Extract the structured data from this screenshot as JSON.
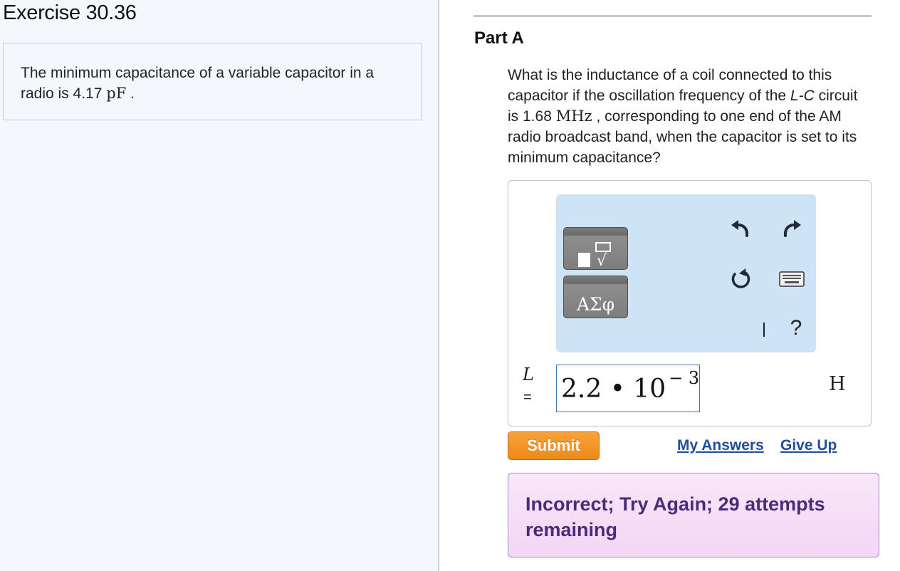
{
  "exercise": {
    "title": "Exercise 30.36"
  },
  "problem": {
    "text_before": "The minimum capacitance of a variable capacitor in a radio is ",
    "value": "4.17",
    "unit": "pF",
    "text_after": " ."
  },
  "part": {
    "title": "Part A",
    "question": {
      "t1": "What is the inductance of a coil connected to this capacitor if the oscillation frequency of the ",
      "circuit": "L-C",
      "t2": " circuit is 1.68 ",
      "freq_unit": "MHz",
      "t3": " , corresponding to one end of the AM radio broadcast band, when the capacitor is set to its minimum capacitance?"
    }
  },
  "toolbar": {
    "templates_icon": "templates-icon",
    "greek_label": "ΑΣφ",
    "undo_icon": "undo-icon",
    "redo_icon": "redo-icon",
    "reset_icon": "reset-icon",
    "keyboard_icon": "keyboard-icon",
    "help_label": "?"
  },
  "answer": {
    "variable": "L",
    "equals": "=",
    "mantissa": "2.2 • 10",
    "exponent": "− 3",
    "unit": "H"
  },
  "actions": {
    "submit": "Submit",
    "my_answers": "My Answers",
    "give_up": "Give Up"
  },
  "feedback": {
    "text": "Incorrect; Try Again; 29 attempts remaining"
  },
  "colors": {
    "submit": "#ec8a17",
    "link": "#1f4e9c",
    "feedback_bg": "#f5ddf6",
    "feedback_text": "#4c2a7a",
    "toolbar_bg": "#cfe3f7"
  }
}
